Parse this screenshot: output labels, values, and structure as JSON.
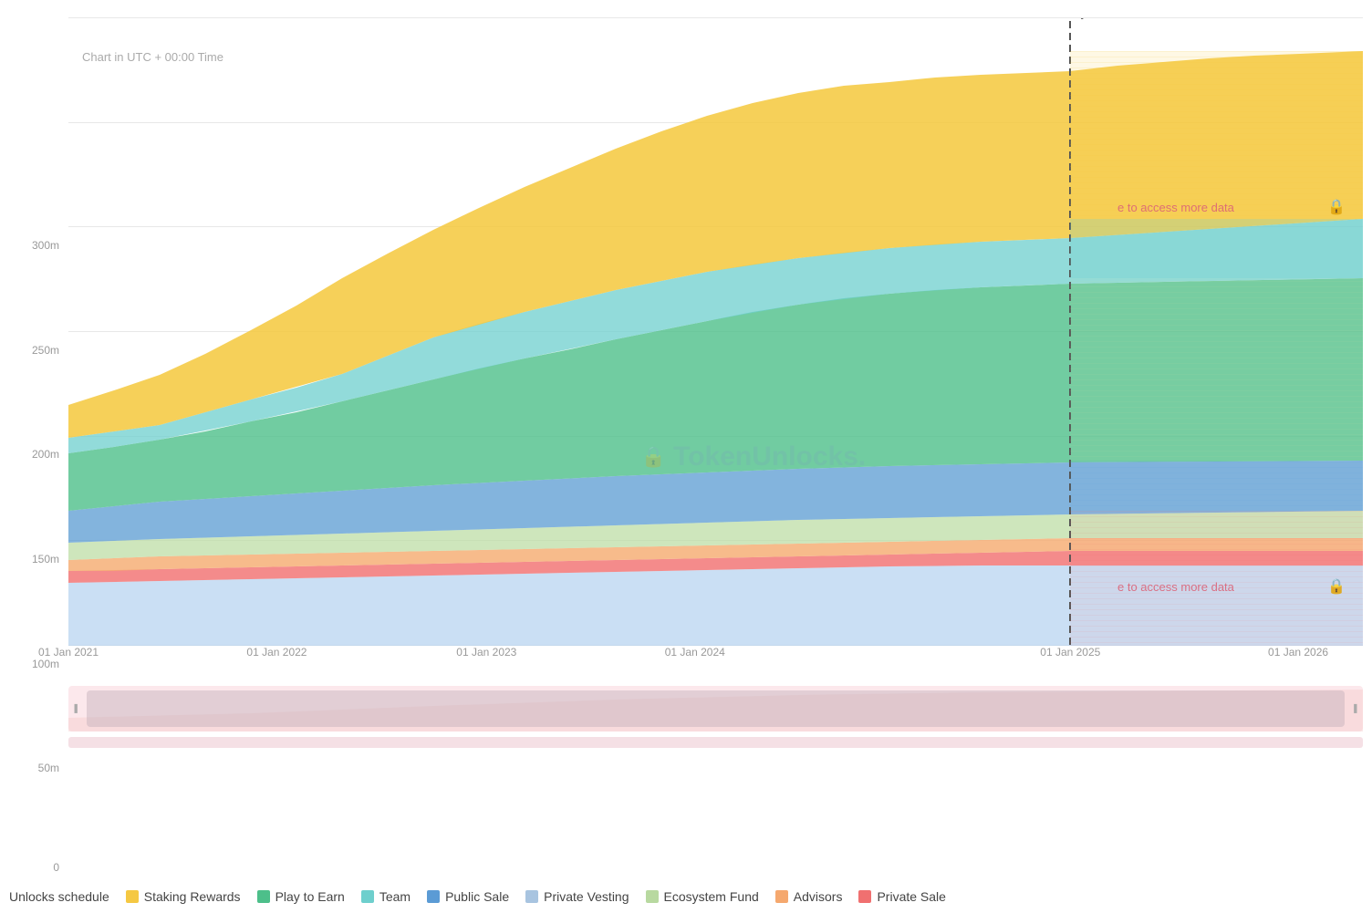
{
  "chart": {
    "title": "Chart in UTC + 00:00 Time",
    "today_label": "Today",
    "y_labels": [
      "0",
      "50m",
      "100m",
      "150m",
      "200m",
      "250m",
      "300m"
    ],
    "x_labels": [
      "01 Jan 2021",
      "01 Jan 2022",
      "01 Jan 2023",
      "01 Jan 2024",
      "01 Jan 2025",
      "01 Jan 2026"
    ],
    "locked_message1": "e to access more data",
    "locked_message2": "e to access more data",
    "watermark": "TokenUnlocks."
  },
  "scrollbar": {
    "left_icon": "❚❚",
    "right_icon": "❚❚"
  },
  "legend": {
    "title": "Unlocks schedule",
    "items": [
      {
        "label": "Staking Rewards",
        "color": "#f5c842"
      },
      {
        "label": "Play to Earn",
        "color": "#4dbf8a"
      },
      {
        "label": "Team",
        "color": "#6ecfcd"
      },
      {
        "label": "Public Sale",
        "color": "#5b9bd5"
      },
      {
        "label": "Private Vesting",
        "color": "#a8c4e0"
      },
      {
        "label": "Ecosystem Fund",
        "color": "#b8d9a0"
      },
      {
        "label": "Advisors",
        "color": "#f5a86e"
      },
      {
        "label": "Private Sale",
        "color": "#f07070"
      }
    ]
  }
}
